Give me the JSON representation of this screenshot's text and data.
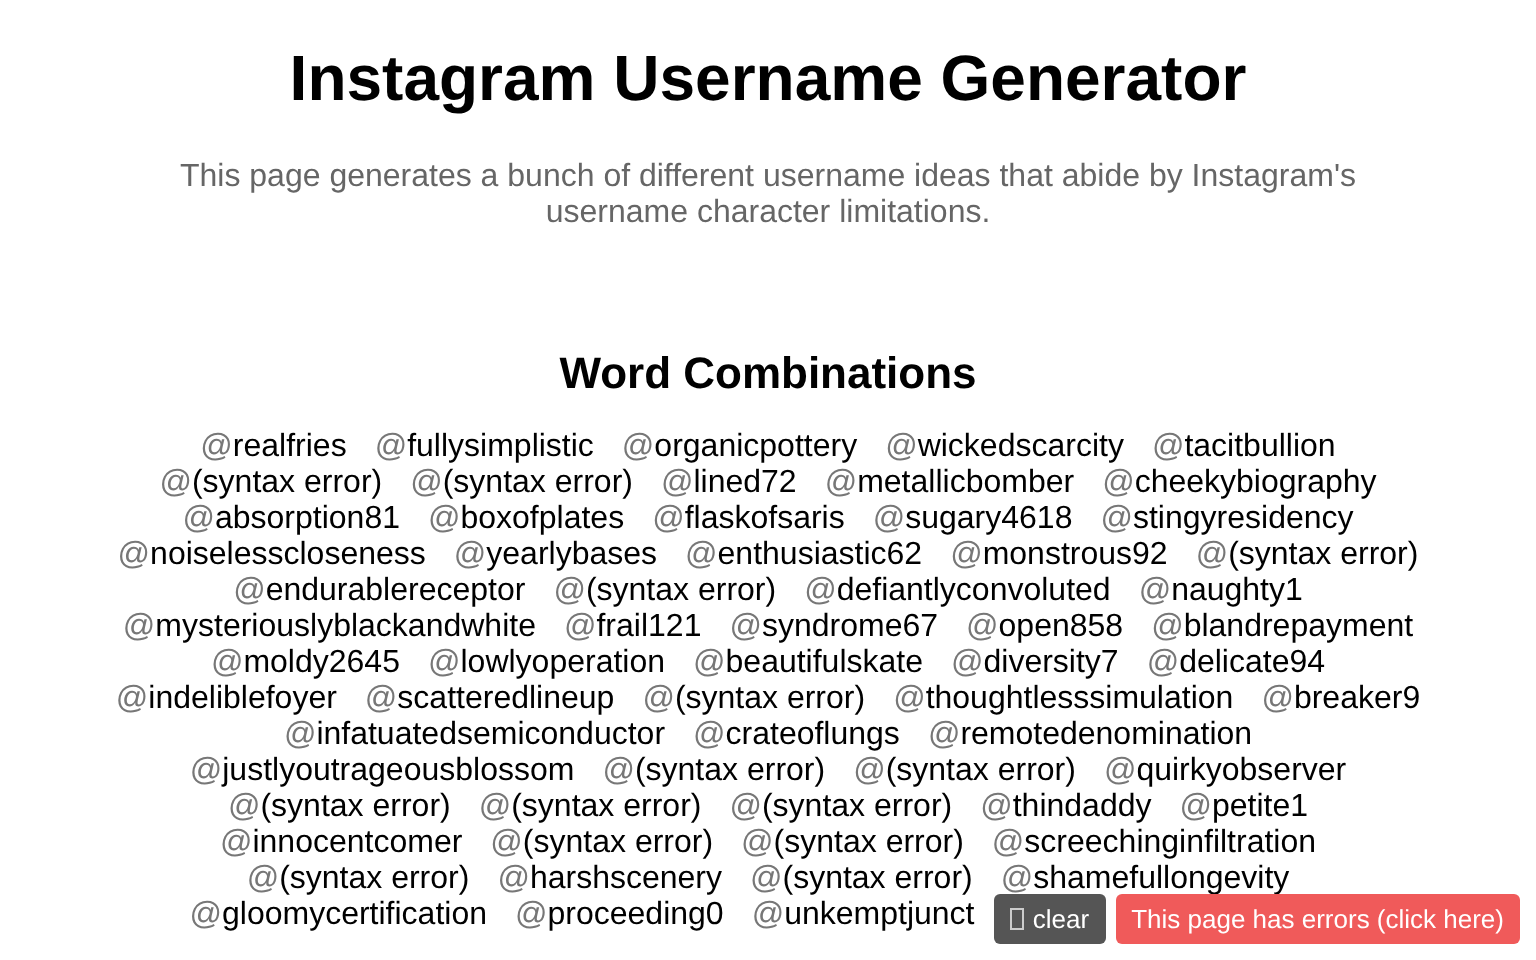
{
  "title": "Instagram Username Generator",
  "description": "This page generates a bunch of different username ideas that abide by Instagram's username character limitations.",
  "section_title": "Word Combinations",
  "prefix": "@",
  "rows": [
    {
      "names": [
        "realfries",
        "fullysimplistic",
        "organicpottery",
        "wickedscarcity",
        "tacitbullion"
      ]
    },
    {
      "names": [
        "(syntax error)",
        "(syntax error)",
        "lined72",
        "metallicbomber",
        "cheekybiography"
      ]
    },
    {
      "names": [
        "absorption81",
        "boxofplates",
        "flaskofsaris",
        "sugary4618",
        "stingyresidency"
      ]
    },
    {
      "names": [
        "noiselesscloseness",
        "yearlybases",
        "enthusiastic62",
        "monstrous92",
        "(syntax error)"
      ]
    },
    {
      "names": [
        "endurablereceptor",
        "(syntax error)",
        "defiantlyconvoluted",
        "naughty1"
      ]
    },
    {
      "names": [
        "mysteriouslyblackandwhite",
        "frail121",
        "syndrome67",
        "open858",
        "blandrepayment"
      ]
    },
    {
      "names": [
        "moldy2645",
        "lowlyoperation",
        "beautifulskate",
        "diversity7",
        "delicate94"
      ]
    },
    {
      "names": [
        "indeliblefoyer",
        "scatteredlineup",
        "(syntax error)",
        "thoughtlesssimulation",
        "breaker9"
      ]
    },
    {
      "names": [
        "infatuatedsemiconductor",
        "crateoflungs",
        "remotedenomination"
      ]
    },
    {
      "names": [
        "justlyoutrageousblossom",
        "(syntax error)",
        "(syntax error)",
        "quirkyobserver"
      ]
    },
    {
      "names": [
        "(syntax error)",
        "(syntax error)",
        "(syntax error)",
        "thindaddy",
        "petite1"
      ]
    },
    {
      "names": [
        "innocentcomer",
        "(syntax error)",
        "(syntax error)",
        "screechinginfiltration"
      ]
    },
    {
      "names": [
        "(syntax error)",
        "harshscenery",
        "(syntax error)",
        "shamefullongevity"
      ]
    },
    {
      "names": [
        "gloomycertification",
        "proceeding0",
        "unkemptjunct"
      ],
      "covered_tail": true
    }
  ],
  "console": {
    "clear_label": "clear",
    "error_label": "This page has errors (click here)"
  }
}
